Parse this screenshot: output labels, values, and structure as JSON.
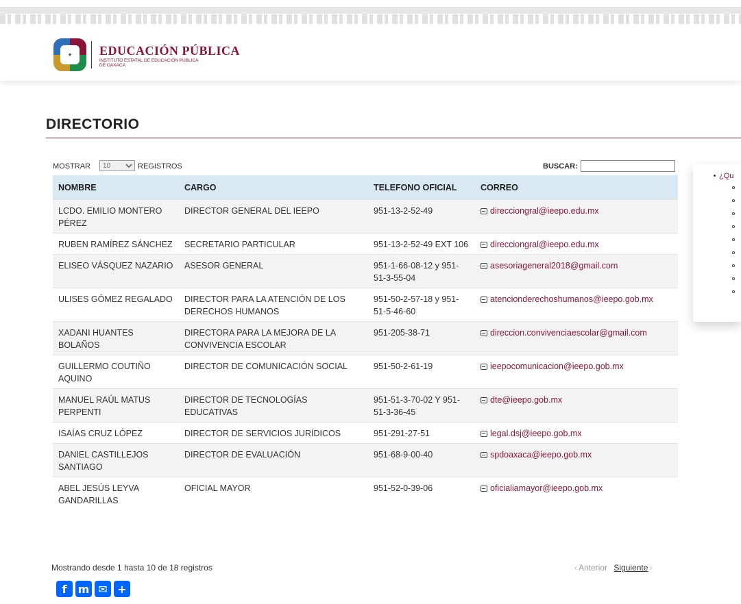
{
  "header": {
    "brand_title": "EDUCACIÓN PÚBLICA",
    "brand_sub_line1": "INSTITUTO ESTATAL DE EDUCACIÓN PÚBLICA",
    "brand_sub_line2": "DE OAXACA"
  },
  "page": {
    "title": "DIRECTORIO"
  },
  "controls": {
    "show_label": "MOSTRAR",
    "page_size": "10",
    "records_label": "REGISTROS",
    "search_label": "BUSCAR:",
    "search_value": ""
  },
  "table": {
    "headers": [
      "NOMBRE",
      "CARGO",
      "TELEFONO OFICIAL",
      "CORREO"
    ],
    "rows": [
      {
        "name": "LCDO. EMILIO MONTERO PÉREZ",
        "role": "DIRECTOR GENERAL DEL IEEPO",
        "phone": "951-13-2-52-49",
        "email": "direcciongral@ieepo.edu.mx"
      },
      {
        "name": "RUBEN RAMÍREZ SÁNCHEZ",
        "role": "SECRETARIO PARTICULAR",
        "phone": "951-13-2-52-49 EXT 106",
        "email": "direcciongral@ieepo.edu.mx"
      },
      {
        "name": "ELISEO VÁSQUEZ NAZARIO",
        "role": "ASESOR GENERAL",
        "phone": "951-1-66-08-12 y 951-51-3-55-04",
        "email": "asesoriageneral2018@gmail.com"
      },
      {
        "name": "ULISES GÓMEZ REGALADO",
        "role": "DIRECTOR PARA LA ATENCIÓN DE LOS DERECHOS HUMANOS",
        "phone": "951-50-2-57-18 y 951-51-5-46-60",
        "email": "atencionderechoshumanos@ieepo.gob.mx"
      },
      {
        "name": "XADANI HUANTES BOLAÑOS",
        "role": "DIRECTORA PARA LA MEJORA DE LA CONVIVENCIA ESCOLAR",
        "phone": "951-205-38-71",
        "email": "direccion.convivenciaescolar@gmail.com"
      },
      {
        "name": "GUILLERMO COUTIÑO AQUINO",
        "role": "DIRECTOR DE COMUNICACIÓN SOCIAL",
        "phone": "951-50-2-61-19",
        "email": "ieepocomunicacion@ieepo.gob.mx"
      },
      {
        "name": "MANUEL RAÚL MATUS PERPENTI",
        "role": "DIRECTOR DE TECNOLOGÍAS EDUCATIVAS",
        "phone": "951-51-3-70-02 Y 951-51-3-36-45",
        "email": "dte@ieepo.gob.mx"
      },
      {
        "name": "ISAÍAS CRUZ LÓPEZ",
        "role": "DIRECTOR DE SERVICIOS JURÍDICOS",
        "phone": "951-291-27-51",
        "email": "legal.dsj@ieepo.gob.mx"
      },
      {
        "name": "DANIEL CASTILLEJOS SANTIAGO",
        "role": "DIRECTOR DE EVALUACIÓN",
        "phone": "951-68-9-00-40",
        "email": "spdoaxaca@ieepo.gob.mx"
      },
      {
        "name": "ABEL JESÚS LEYVA GANDARILLAS",
        "role": "OFICIAL MAYOR",
        "phone": "951-52-0-39-06",
        "email": "oficialiamayor@ieepo.gob.mx"
      }
    ]
  },
  "footer": {
    "info": "Mostrando desde 1 hasta 10 de 18 registros",
    "prev": "Anterior",
    "next": "Siguiente"
  },
  "share": {
    "icons": [
      "facebook-icon",
      "mastodon-icon",
      "email-icon",
      "add-share-icon"
    ]
  },
  "side_panel": {
    "link_text": "¿Qu"
  },
  "colors": {
    "brand": "#8a1538",
    "header_row": "#d9e9f4",
    "share_blue": "#0166ff"
  }
}
